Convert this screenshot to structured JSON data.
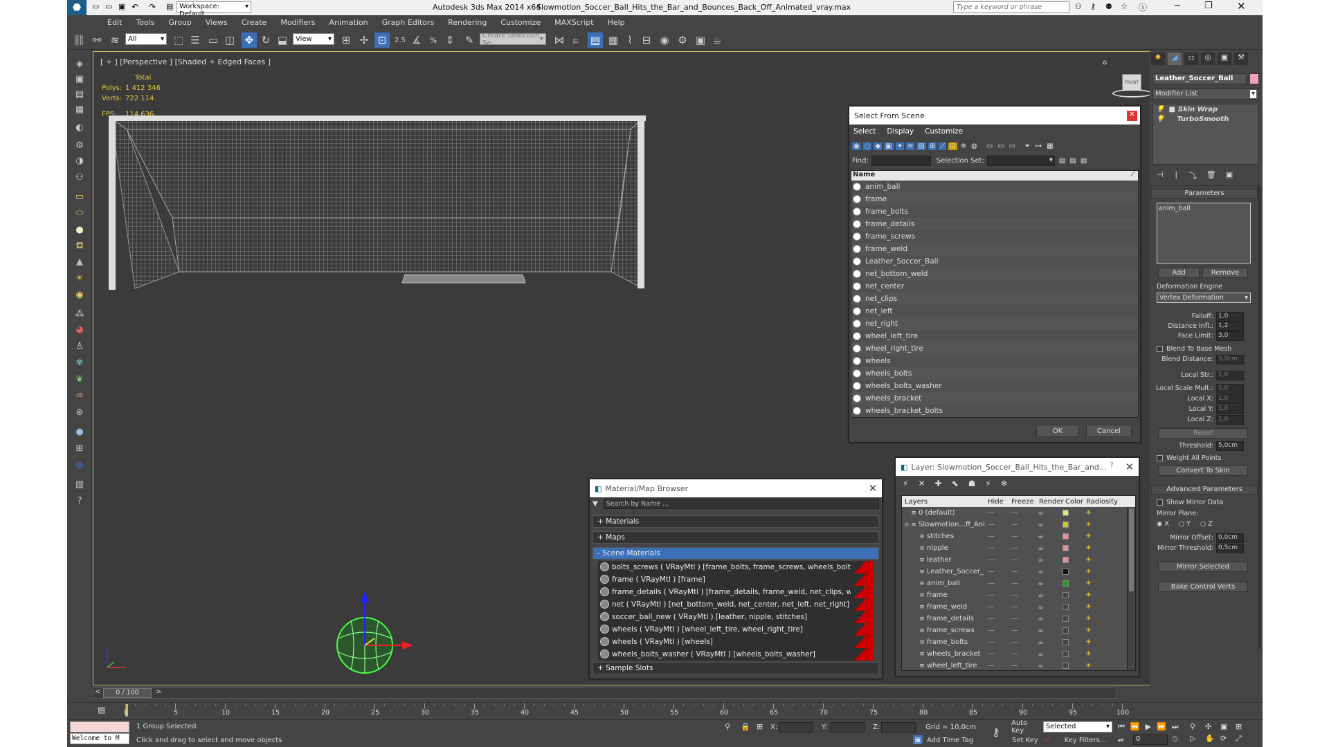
{
  "titlebar": {
    "workspace": "Workspace: Default",
    "app_title": "Autodesk 3ds Max  2014 x64",
    "file_name": "Slowmotion_Soccer_Ball_Hits_the_Bar_and_Bounces_Back_Off_Animated_vray.max",
    "search_placeholder": "Type a keyword or phrase"
  },
  "menu": [
    "Edit",
    "Tools",
    "Group",
    "Views",
    "Create",
    "Modifiers",
    "Animation",
    "Graph Editors",
    "Rendering",
    "Customize",
    "MAXScript",
    "Help"
  ],
  "toolbar": {
    "filter": "All",
    "ref_coord": "View",
    "selection_set": "Create Selection Se",
    "snap_label": "2.5"
  },
  "viewport": {
    "label": "[ + ] [Perspective ] [Shaded + Edged Faces ]",
    "stats_total": "Total",
    "polys_label": "Polys:",
    "polys_value": "1 412 346",
    "verts_label": "Verts:",
    "verts_value": "722 114",
    "fps_label": "FPS:",
    "fps_value": "114,636",
    "viewcube_label": "FRONT"
  },
  "select_from_scene": {
    "title": "Select From Scene",
    "menu": [
      "Select",
      "Display",
      "Customize"
    ],
    "find_label": "Find:",
    "selection_set_label": "Selection Set:",
    "column_name": "Name",
    "items": [
      "anim_ball",
      "frame",
      "frame_bolts",
      "frame_details",
      "frame_screws",
      "frame_weld",
      "Leather_Soccer_Ball",
      "net_bottom_weld",
      "net_center",
      "net_clips",
      "net_left",
      "net_right",
      "wheel_left_tire",
      "wheel_right_tire",
      "wheels",
      "wheels_bolts",
      "wheels_bolts_washer",
      "wheels_bracket",
      "wheels_bracket_bolts"
    ],
    "ok": "OK",
    "cancel": "Cancel"
  },
  "material_browser": {
    "title": "Material/Map Browser",
    "search_placeholder": "Search by Name ...",
    "sections": {
      "materials": "+ Materials",
      "maps": "+ Maps",
      "scene_materials": "- Scene Materials",
      "sample_slots": "+ Sample Slots"
    },
    "scene_materials": [
      "bolts_screws  ( VRayMtl ) [frame_bolts, frame_screws, wheels_bolts, wheels_br...",
      "frame  ( VRayMtl ) [frame]",
      "frame_details  ( VRayMtl ) [frame_details, frame_weld, net_clips, wheels_bracket]",
      "net  ( VRayMtl ) [net_bottom_weld, net_center, net_left, net_right]",
      "soccer_ball_new  ( VRayMtl ) [leather, nipple, stitches]",
      "wheels  ( VRayMtl ) [wheel_left_tire, wheel_right_tire]",
      "wheels  ( VRayMtl ) [wheels]",
      "wheels_bolts_washer  ( VRayMtl ) [wheels_bolts_washer]"
    ]
  },
  "layer_manager": {
    "title": "Layer: Slowmotion_Soccer_Ball_Hits_the_Bar_and...",
    "help": "?",
    "columns": [
      "Layers",
      "Hide",
      "Freeze",
      "Render",
      "Color",
      "Radiosity"
    ],
    "rows": [
      {
        "name": "0 (default)",
        "color": "#e8e870",
        "indent": 0
      },
      {
        "name": "Slowmotion...ff_Ani",
        "color": "#c8c830",
        "indent": 0
      },
      {
        "name": "stitches",
        "color": "#e89090",
        "indent": 1
      },
      {
        "name": "nipple",
        "color": "#e89090",
        "indent": 1
      },
      {
        "name": "leather",
        "color": "#e89090",
        "indent": 1
      },
      {
        "name": "Leather_Soccer_",
        "color": "#111111",
        "indent": 1
      },
      {
        "name": "anim_ball",
        "color": "#20a020",
        "indent": 1
      },
      {
        "name": "frame",
        "color": "#444444",
        "indent": 1
      },
      {
        "name": "frame_weld",
        "color": "#444444",
        "indent": 1
      },
      {
        "name": "frame_details",
        "color": "#444444",
        "indent": 1
      },
      {
        "name": "frame_screws",
        "color": "#444444",
        "indent": 1
      },
      {
        "name": "frame_bolts",
        "color": "#444444",
        "indent": 1
      },
      {
        "name": "wheels_bracket",
        "color": "#444444",
        "indent": 1
      },
      {
        "name": "wheel_left_tire",
        "color": "#444444",
        "indent": 1
      }
    ]
  },
  "command_panel": {
    "object_name": "Leather_Soccer_Ball",
    "modifier_list": "Modifier List",
    "stack": [
      "Skin Wrap",
      "TurboSmooth"
    ],
    "parameters_title": "Parameters",
    "param_list_item": "anim_ball",
    "add": "Add",
    "remove": "Remove",
    "deformation_engine_label": "Deformation Engine",
    "deformation_engine": "Vertex Deformation",
    "params": [
      {
        "label": "Falloff:",
        "value": "1,0"
      },
      {
        "label": "Distance Infl.:",
        "value": "1,2"
      },
      {
        "label": "Face Limit:",
        "value": "3,0"
      }
    ],
    "blend_to_base": "Blend To Base Mesh",
    "blend_distance_label": "Blend Distance:",
    "blend_distance": "5,0cm",
    "local_params": [
      {
        "label": "Local Str.:",
        "value": "1,0"
      },
      {
        "label": "Local Scale Mult.:",
        "value": "1,0"
      },
      {
        "label": "Local X:",
        "value": "1,0"
      },
      {
        "label": "Local Y:",
        "value": "1,0"
      },
      {
        "label": "Local Z:",
        "value": "1,0"
      }
    ],
    "reset": "Reset",
    "threshold_label": "Threshold:",
    "threshold": "5,0cm",
    "weight_all_points": "Weight All Points",
    "convert_to_skin": "Convert To Skin",
    "advanced_title": "Advanced Parameters",
    "show_mirror": "Show Mirror Data",
    "mirror_plane": "Mirror Plane:",
    "axes": [
      "X",
      "Y",
      "Z"
    ],
    "mirror_offset_label": "Mirror Offset:",
    "mirror_offset": "0,0cm",
    "mirror_threshold_label": "Mirror Threshold:",
    "mirror_threshold": "0,5cm",
    "mirror_selected": "Mirror Selected",
    "bake_control": "Bake Control Verts"
  },
  "timeline": {
    "frame_display": "0 / 100",
    "ticks": [
      "0",
      "5",
      "10",
      "15",
      "20",
      "25",
      "30",
      "35",
      "40",
      "45",
      "50",
      "55",
      "60",
      "65",
      "70",
      "75",
      "80",
      "85",
      "90",
      "95",
      "100"
    ]
  },
  "status": {
    "maxscript": "Welcome to M",
    "selected": "1 Group Selected",
    "prompt": "Click and drag to select and move objects",
    "x_label": "X:",
    "y_label": "Y:",
    "z_label": "Z:",
    "grid": "Grid = 10,0cm",
    "add_time_tag": "Add Time Tag",
    "auto_key": "Auto Key",
    "set_key": "Set Key",
    "key_mode": "Selected",
    "key_filters": "Key Filters...",
    "current_frame": "0"
  }
}
